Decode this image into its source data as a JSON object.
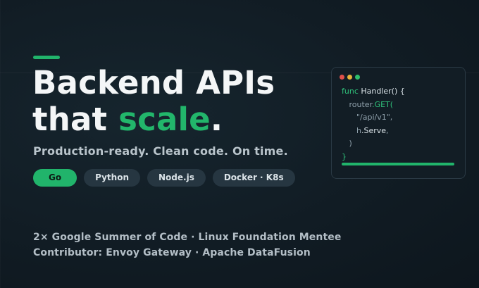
{
  "hero": {
    "line1": "Backend APIs",
    "line2_prefix": "that ",
    "line2_highlight": "scale",
    "line2_suffix": ".",
    "subtitle": "Production-ready. Clean code. On time."
  },
  "tags": [
    "Go",
    "Python",
    "Node.js",
    "Docker · K8s"
  ],
  "credits": {
    "line1": "2× Google Summer of Code  ·  Linux Foundation Mentee",
    "line2": "Contributor: Envoy Gateway  ·  Apache DataFusion"
  },
  "code_window": {
    "line1_keyword": "func",
    "line1_rest": " Handler() {",
    "line2_obj": "router",
    "line2_method": ".GET(",
    "line3": "\"/api/v1\",",
    "line4_obj": "h",
    "line4_method": ".Serve",
    "line4_end": ",",
    "line5": ")",
    "line6": "}"
  },
  "colors": {
    "accent": "#21b46b",
    "background": "#111c24",
    "chip": "#263641",
    "dot_red": "#e0504a",
    "dot_yellow": "#e6b23a",
    "dot_green": "#2fbf6b"
  }
}
